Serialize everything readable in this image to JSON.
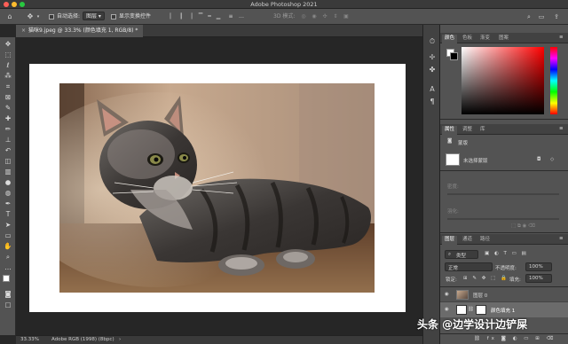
{
  "window": {
    "title": "Adobe Photoshop 2021"
  },
  "options_bar": {
    "auto_select_label": "自动选择:",
    "auto_select_value": "图层",
    "show_transform_label": "显示变换控件",
    "mode_3d_label": "3D 模式:"
  },
  "document": {
    "tab_label": "猫咪9.jpeg @ 33.3% (颜色填充 1, RGB/8) *",
    "zoom": "33.33%",
    "color_profile": "Adobe RGB (1998) (8bpc)"
  },
  "color_panel": {
    "tabs": [
      "颜色",
      "色板",
      "渐变",
      "图案"
    ]
  },
  "properties_panel": {
    "tabs": [
      "属性",
      "调整",
      "库"
    ],
    "section_label": "蒙版",
    "mask_label": "未选择蒙版",
    "density_label": "密度:",
    "feather_label": "羽化:"
  },
  "layers_panel": {
    "tabs": [
      "图层",
      "通道",
      "路径"
    ],
    "filter_label": "类型",
    "blend_mode": "正常",
    "opacity_label": "不透明度:",
    "opacity_value": "100%",
    "lock_label": "锁定:",
    "fill_label": "填充:",
    "fill_value": "100%",
    "layers": [
      {
        "name": "图层 0"
      },
      {
        "name": "颜色填充 1"
      }
    ]
  },
  "watermark": {
    "text": "头条 @边学设计边铲屎"
  },
  "colors": {
    "panel_bg": "#535353",
    "canvas_bg": "#262626",
    "accent": "#ff0000"
  }
}
